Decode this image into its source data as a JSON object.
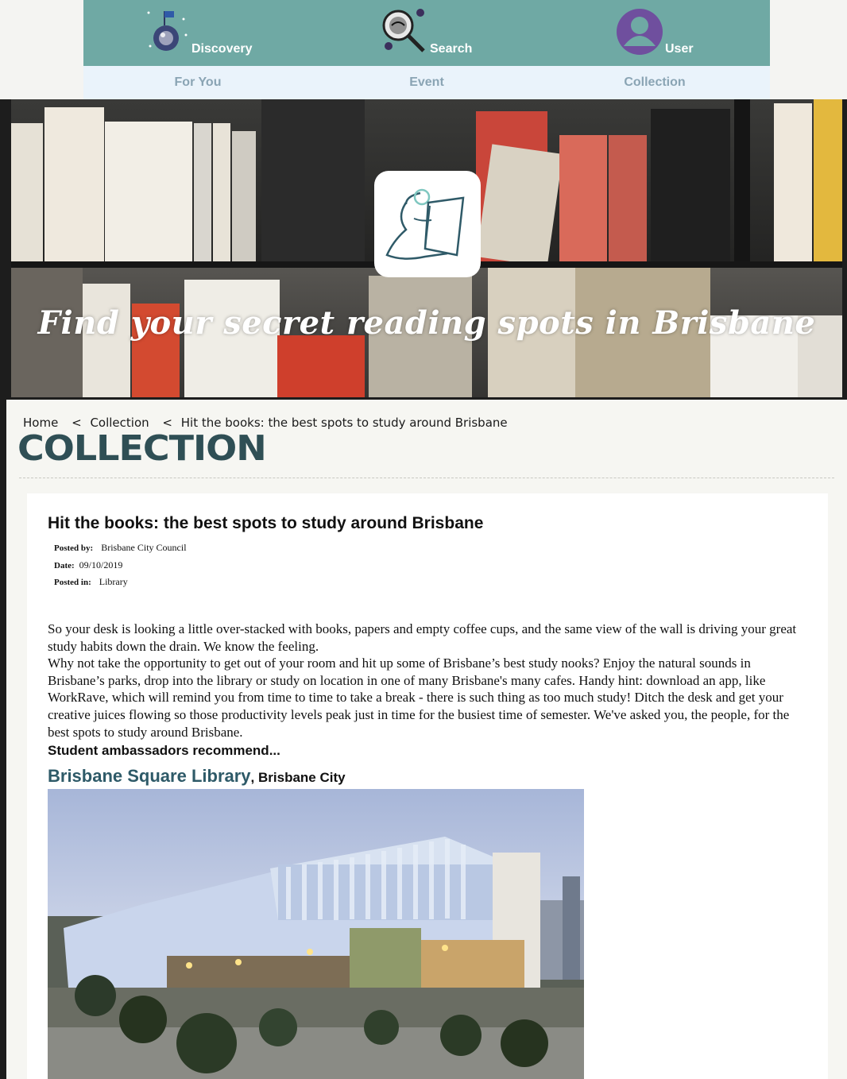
{
  "nav": {
    "items": [
      {
        "label": "Discovery",
        "icon": "planet-flag-icon"
      },
      {
        "label": "Search",
        "icon": "magnifier-face-icon"
      },
      {
        "label": "User",
        "icon": "user-avatar-icon"
      }
    ],
    "sub_items": [
      "For You",
      "Event",
      "Collection"
    ],
    "bar_color": "#6fa9a4",
    "sub_color": "#eaf3fb"
  },
  "hero": {
    "tagline": "Find your secret reading spots in Brisbane",
    "logo_icon": "platypus-reading-icon"
  },
  "breadcrumb": [
    "Home",
    "Collection",
    "Hit the books: the best spots to study around Brisbane"
  ],
  "breadcrumb_sep": "<",
  "section_heading": "COLLECTION",
  "article": {
    "title": "Hit the books: the best spots to study around Brisbane",
    "posted_by_label": "Posted by:",
    "posted_by": "Brisbane City Council",
    "date_label": "Date:",
    "date": "09/10/2019",
    "posted_in_label": "Posted in:",
    "posted_in": "Library",
    "paragraph1": "So your desk is looking a little over-stacked with books, papers and empty coffee cups, and the same view of the wall is driving your great study habits down the drain. We know the feeling.",
    "paragraph2": "Why not take the opportunity to get out of your room and hit up some of Brisbane’s best study nooks? Enjoy the natural sounds in Brisbane’s parks, drop into the library or study on location in one of many Brisbane's many cafes. Handy hint: download an app, like WorkRave, which will remind you from time to time to take a break - there is such thing as too much study! Ditch the desk and get your creative juices flowing so those productivity levels peak just in time for the busiest time of semester. We've asked you, the people, for the best spots to study around Brisbane.",
    "subheading": "Student ambassadors recommend...",
    "place_name": "Brisbane Square Library",
    "place_suffix": ", Brisbane City"
  }
}
